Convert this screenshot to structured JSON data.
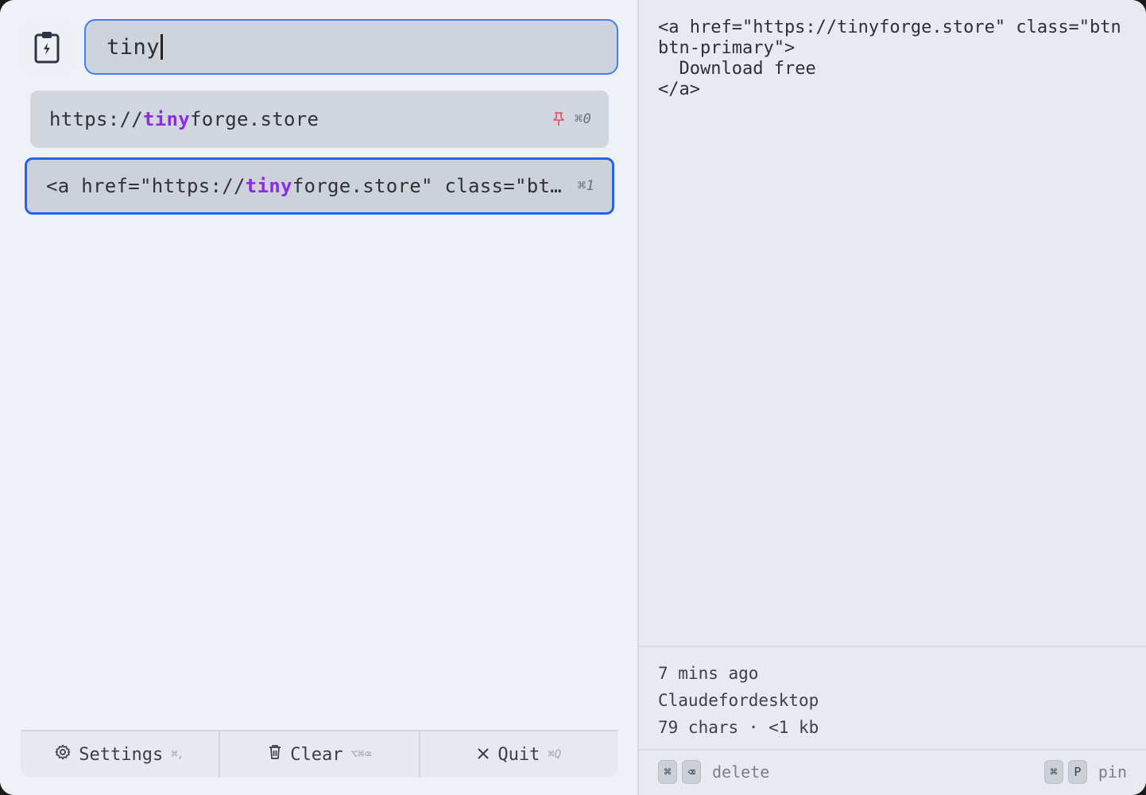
{
  "search": {
    "value": "tiny"
  },
  "items": [
    {
      "prefix": "https://",
      "match": "tiny",
      "suffix": "forge.store",
      "shortcut": "⌘0",
      "pinned": true
    },
    {
      "prefix": "<a href=\"https://",
      "match": "tiny",
      "suffix": "forge.store\" class=\"bt…",
      "shortcut": "⌘1",
      "pinned": false
    }
  ],
  "bottom_bar": {
    "settings": {
      "label": "Settings",
      "shortcut": "⌘,"
    },
    "clear": {
      "label": "Clear",
      "shortcut": "⌥⌘⌫"
    },
    "quit": {
      "label": "Quit",
      "shortcut": "⌘Q"
    }
  },
  "preview": {
    "content": "<a href=\"https://tinyforge.store\" class=\"btn\nbtn-primary\">\n  Download free\n</a>"
  },
  "meta": {
    "time": "7 mins ago",
    "source": "Claudefordesktop",
    "size": "79 chars · <1 kb"
  },
  "actions": {
    "delete": {
      "keys": [
        "⌘",
        "⌫"
      ],
      "label": "delete"
    },
    "pin": {
      "keys": [
        "⌘",
        "P"
      ],
      "label": "pin"
    }
  },
  "colors": {
    "accent": "#3b82f6",
    "highlight": "#8b2be2",
    "pin": "#e05a6a"
  }
}
